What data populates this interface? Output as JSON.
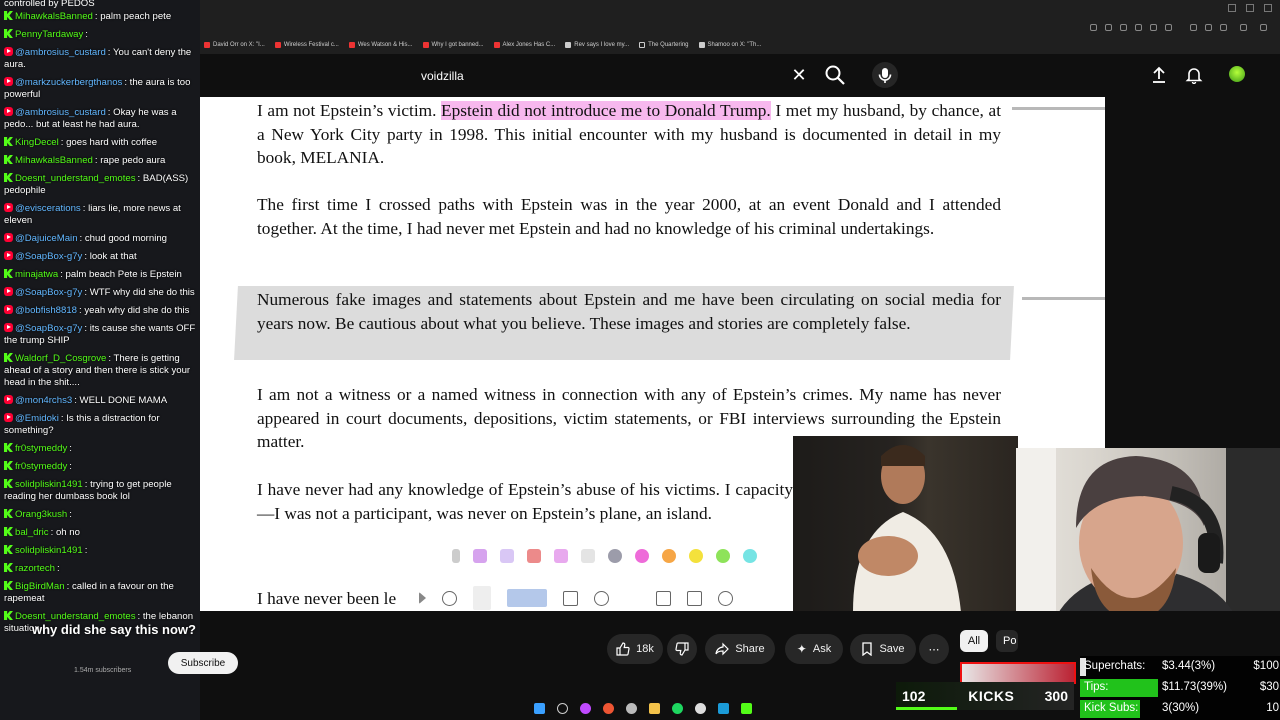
{
  "chat": {
    "top_text": "controlled by PEDOS",
    "messages": [
      {
        "platform": "kick",
        "user": "MihawkalsBanned",
        "text": "palm peach pete"
      },
      {
        "platform": "kick",
        "user": "PennyTardaway",
        "text": ""
      },
      {
        "platform": "youtube",
        "user": "@ambrosius_custard",
        "text": "You can't deny the aura."
      },
      {
        "platform": "youtube",
        "user": "@markzuckerbergthanos",
        "text": "the aura is too powerful"
      },
      {
        "platform": "youtube",
        "user": "@ambrosius_custard",
        "text": "Okay he was a pedo... but at least he had aura."
      },
      {
        "platform": "kick",
        "user": "KingDecel",
        "text": "goes hard with coffee"
      },
      {
        "platform": "kick",
        "user": "MihawkalsBanned",
        "text": "rape pedo aura"
      },
      {
        "platform": "kick",
        "user": "Doesnt_understand_emotes",
        "text": "BAD(ASS) pedophile"
      },
      {
        "platform": "youtube",
        "user": "@eviscerations",
        "text": "liars lie, more news at eleven"
      },
      {
        "platform": "youtube",
        "user": "@DajuiceMain",
        "text": "chud good morning"
      },
      {
        "platform": "youtube",
        "user": "@SoapBox-g7y",
        "text": "look at that"
      },
      {
        "platform": "kick",
        "user": "minajatwa",
        "text": "palm beach Pete is Epstein"
      },
      {
        "platform": "youtube",
        "user": "@SoapBox-g7y",
        "text": "WTF why did she do this"
      },
      {
        "platform": "youtube",
        "user": "@bobfish8818",
        "text": "yeah why did she do this"
      },
      {
        "platform": "youtube",
        "user": "@SoapBox-g7y",
        "text": "its cause she wants OFF the trump SHIP"
      },
      {
        "platform": "kick",
        "user": "Waldorf_D_Cosgrove",
        "text": "There is getting ahead of a story and then there is stick your head in the shit...."
      },
      {
        "platform": "youtube",
        "user": "@mon4rchs3",
        "text": "WELL DONE MAMA"
      },
      {
        "platform": "youtube",
        "user": "@Emidoki",
        "text": "Is this a distraction for something?"
      },
      {
        "platform": "kick",
        "user": "fr0stymeddy",
        "text": ""
      },
      {
        "platform": "kick",
        "user": "fr0stymeddy",
        "text": ""
      },
      {
        "platform": "kick",
        "user": "solidpliskin1491",
        "text": "trying to get people reading her dumbass book lol"
      },
      {
        "platform": "kick",
        "user": "Orang3kush",
        "text": ""
      },
      {
        "platform": "kick",
        "user": "bal_dric",
        "text": "oh no"
      },
      {
        "platform": "kick",
        "user": "solidpliskin1491",
        "text": ""
      },
      {
        "platform": "kick",
        "user": "razortech",
        "text": ""
      },
      {
        "platform": "kick",
        "user": "BigBirdMan",
        "text": "called in a favour on the rapemeat"
      },
      {
        "platform": "kick",
        "user": "Doesnt_understand_emotes",
        "text": "the lebanon situation"
      }
    ]
  },
  "browser": {
    "bookmarks": [
      "David Orr on X: \"I...",
      "Wireless Festival c...",
      "Wes Watson & His...",
      "Why I got banned...",
      "Alex Jones Has C...",
      "Rev says I love my...",
      "The Quartering",
      "Shamoo on X: \"Th..."
    ]
  },
  "youtube": {
    "search_value": "voidzilla",
    "caption_overlay": "why did she say this now?",
    "subscribe_label": "Subscribe",
    "channel_subs": "1.54m subscribers",
    "likes": "18k",
    "share_label": "Share",
    "ask_label": "Ask",
    "save_label": "Save",
    "more_label": "⋯",
    "chip_all": "All",
    "chip_po": "Po"
  },
  "document": {
    "p1_before": "I am not Epstein’s victim. ",
    "p1_highlight": "Epstein did not introduce me to Donald Trump.",
    "p1_after": " I met my husband, by chance, at a New York City party in 1998.  This initial encounter with my husband is documented in detail in my book, MELANIA.",
    "p2": "The first time I crossed paths with Epstein was in the year 2000, at an event Donald and I attended together.  At the time, I had never met Epstein and had no knowledge of his criminal undertakings.",
    "p3": "Numerous fake images and statements about Epstein and me have been circulating on social media for years now.  Be cautious about what you believe.  These images and stories are completely false.",
    "p4": "I am not a witness or a named witness in connection with any of Epstein’s crimes.  My name has never appeared in court documents, depositions, victim statements, or FBI interviews surrounding the Epstein matter.",
    "p5": "I have never had any knowledge of Epstein’s abuse of his victims.  I capacity—I was not a participant, was never on Epstein’s plane, an island.",
    "p6": "I have never been le"
  },
  "overlays": {
    "kicks_count": "102",
    "kicks_label": "KICKS",
    "kicks_goal": "300",
    "kicks_progress": 0.34,
    "goals": [
      {
        "label": "Superchats:",
        "value": "$3.44(3%)",
        "target": "$100",
        "progress": 0.03,
        "color": "#ffffff"
      },
      {
        "label": "Tips:",
        "value": "$11.73(39%)",
        "target": "$30",
        "progress": 0.39,
        "color": "#21c21b"
      },
      {
        "label": "Kick Subs:",
        "value": "3(30%)",
        "target": "10",
        "progress": 0.3,
        "color": "#21c21b"
      }
    ]
  }
}
